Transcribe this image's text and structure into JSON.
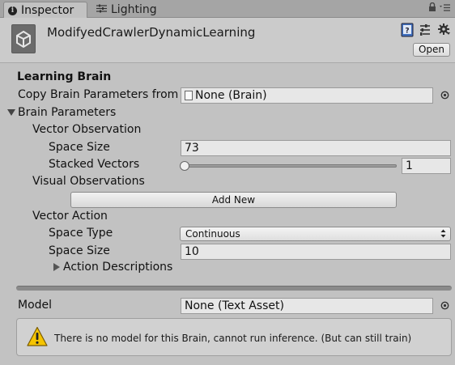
{
  "tabs": {
    "inspector": "Inspector",
    "lighting": "Lighting"
  },
  "header": {
    "object_name": "ModifyedCrawlerDynamicLearning",
    "open_label": "Open"
  },
  "section_title": "Learning Brain",
  "copy_params": {
    "label": "Copy Brain Parameters from",
    "value": "None (Brain)"
  },
  "brain_parameters": {
    "label": "Brain Parameters",
    "vector_observation": {
      "label": "Vector Observation",
      "space_size_label": "Space Size",
      "space_size_value": "73",
      "stacked_vectors_label": "Stacked Vectors",
      "stacked_vectors_value": "1"
    },
    "visual_observations": {
      "label": "Visual Observations",
      "add_new_label": "Add New"
    },
    "vector_action": {
      "label": "Vector Action",
      "space_type_label": "Space Type",
      "space_type_value": "Continuous",
      "space_size_label": "Space Size",
      "space_size_value": "10",
      "action_descriptions_label": "Action Descriptions"
    }
  },
  "model": {
    "label": "Model",
    "value": "None (Text Asset)"
  },
  "help": {
    "text": "There is no model for this Brain, cannot run inference. (But can still train)"
  },
  "colors": {
    "background": "#c2c2c2",
    "warning": "#f5c400"
  }
}
